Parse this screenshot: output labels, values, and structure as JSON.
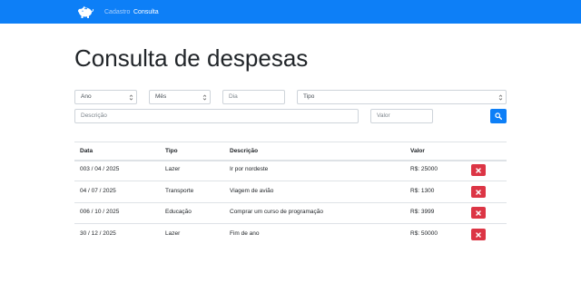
{
  "navbar": {
    "logo_icon": "piggy-bank-icon",
    "links": [
      "Cadastro",
      "Consulta"
    ],
    "active_link": "Consulta",
    "color": "#0d7ff7"
  },
  "page": {
    "title": "Consulta de despesas"
  },
  "filters": {
    "ano": "Ano",
    "mes": "Mês",
    "dia_placeholder": "Dia",
    "tipo": "Tipo",
    "descricao_placeholder": "Descrição",
    "valor_placeholder": "Valor",
    "search_icon": "search-icon"
  },
  "table": {
    "headers": [
      "Data",
      "Tipo",
      "Descrição",
      "Valor"
    ],
    "rows": [
      {
        "data": "003 / 04 / 2025",
        "tipo": "Lazer",
        "descricao": "Ir por nordeste",
        "valor": "R$: 25000"
      },
      {
        "data": "04 / 07 / 2025",
        "tipo": "Transporte",
        "descricao": "Viagem de avião",
        "valor": "R$: 1300"
      },
      {
        "data": "006 / 10 / 2025",
        "tipo": "Educação",
        "descricao": "Comprar um curso de programação",
        "valor": "R$: 3999"
      },
      {
        "data": "30 / 12 / 2025",
        "tipo": "Lazer",
        "descricao": "Fim de ano",
        "valor": "R$: 50000"
      }
    ],
    "delete_icon": "close-icon",
    "delete_color": "#dc3545"
  }
}
